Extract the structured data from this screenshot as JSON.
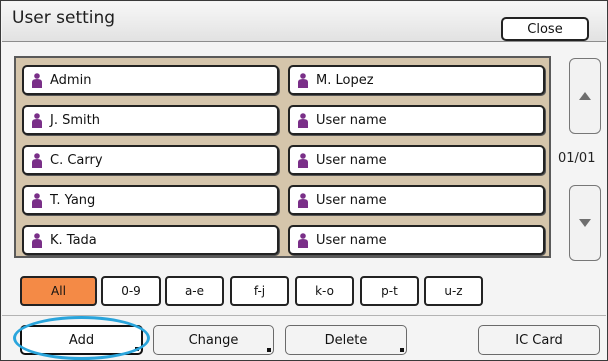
{
  "header": {
    "title": "User setting",
    "close_label": "Close"
  },
  "users": [
    {
      "name": "Admin"
    },
    {
      "name": "M. Lopez"
    },
    {
      "name": "J. Smith"
    },
    {
      "name": "User name"
    },
    {
      "name": "C. Carry"
    },
    {
      "name": "User name"
    },
    {
      "name": "T. Yang"
    },
    {
      "name": "User name"
    },
    {
      "name": "K. Tada"
    },
    {
      "name": "User name"
    }
  ],
  "pagination": {
    "indicator": "01/01"
  },
  "filters": [
    {
      "label": "All",
      "selected": true
    },
    {
      "label": "0-9",
      "selected": false
    },
    {
      "label": "a-e",
      "selected": false
    },
    {
      "label": "f-j",
      "selected": false
    },
    {
      "label": "k-o",
      "selected": false
    },
    {
      "label": "p-t",
      "selected": false
    },
    {
      "label": "u-z",
      "selected": false
    }
  ],
  "actions": {
    "add": "Add",
    "change": "Change",
    "delete": "Delete",
    "ic_card": "IC Card"
  },
  "colors": {
    "accent": "#f48a46",
    "highlight": "#2aa5dc",
    "user_icon": "#7a2f88",
    "list_bg": "#d5c5ab"
  }
}
